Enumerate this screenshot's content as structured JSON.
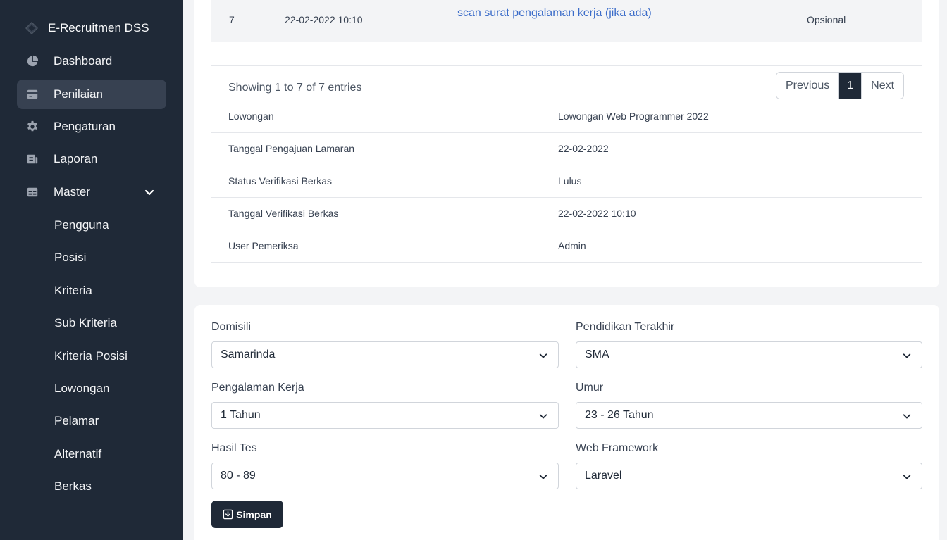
{
  "brand": {
    "name": "E-Recruitmen DSS"
  },
  "nav": [
    {
      "label": "Dashboard",
      "icon": "chart-pie-icon"
    },
    {
      "label": "Penilaian",
      "icon": "credit-card-icon",
      "active": true
    },
    {
      "label": "Pengaturan",
      "icon": "gear-icon"
    },
    {
      "label": "Laporan",
      "icon": "report-icon"
    },
    {
      "label": "Master",
      "icon": "table-icon",
      "expandable": true
    }
  ],
  "master_items": [
    "Pengguna",
    "Posisi",
    "Kriteria",
    "Sub Kriteria",
    "Kriteria Posisi",
    "Lowongan",
    "Pelamar",
    "Alternatif",
    "Berkas"
  ],
  "table_last_row": {
    "no": "7",
    "date": "22-02-2022 10:10",
    "document": "scan surat pengalaman kerja (jika ada)",
    "status": "Opsional"
  },
  "table_info": "Showing 1 to 7 of 7 entries",
  "pagination": {
    "previous": "Previous",
    "current": "1",
    "next": "Next"
  },
  "details": [
    {
      "label": "Lowongan",
      "value": "Lowongan Web Programmer 2022"
    },
    {
      "label": "Tanggal Pengajuan Lamaran",
      "value": "22-02-2022"
    },
    {
      "label": "Status Verifikasi Berkas",
      "value": "Lulus"
    },
    {
      "label": "Tanggal Verifikasi Berkas",
      "value": "22-02-2022 10:10"
    },
    {
      "label": "User Pemeriksa",
      "value": "Admin"
    }
  ],
  "form": {
    "domisili": {
      "label": "Domisili",
      "value": "Samarinda"
    },
    "pendidikan": {
      "label": "Pendidikan Terakhir",
      "value": "SMA"
    },
    "pengalaman": {
      "label": "Pengalaman Kerja",
      "value": "1 Tahun"
    },
    "umur": {
      "label": "Umur",
      "value": "23 - 26 Tahun"
    },
    "hasil_tes": {
      "label": "Hasil Tes",
      "value": "80 - 89"
    },
    "framework": {
      "label": "Web Framework",
      "value": "Laravel"
    },
    "save_label": "Simpan"
  },
  "colors": {
    "sidebar_bg": "#1f2937",
    "active_bg": "#374151",
    "link": "#3b6cc9",
    "accent_dark": "#1f2937"
  }
}
